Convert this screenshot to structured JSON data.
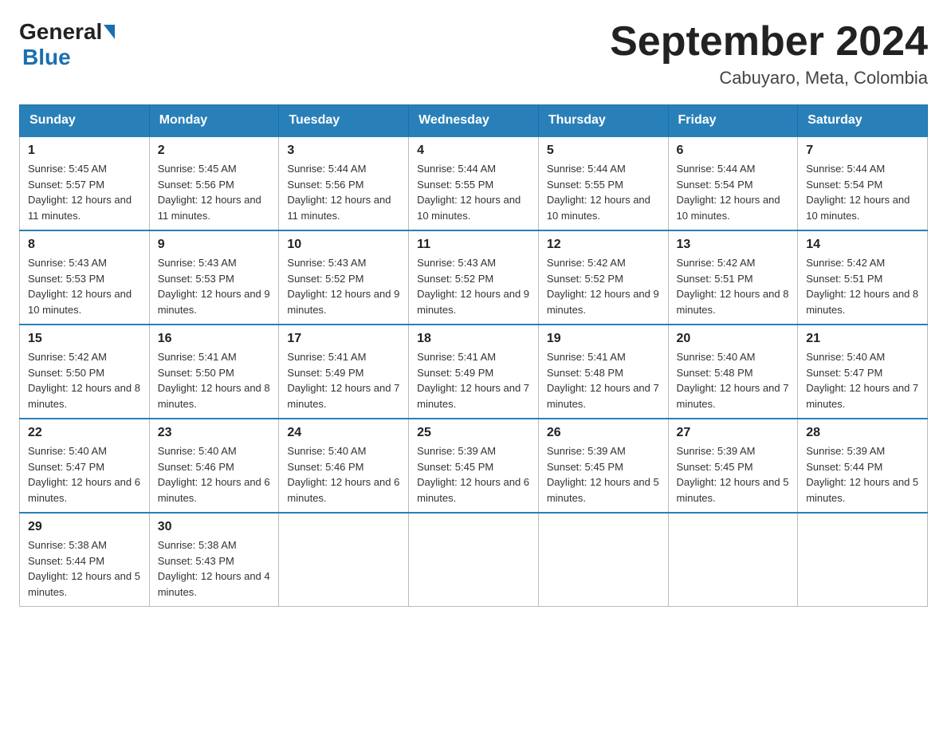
{
  "logo": {
    "general": "General",
    "blue": "Blue"
  },
  "header": {
    "month_year": "September 2024",
    "location": "Cabuyaro, Meta, Colombia"
  },
  "days_of_week": [
    "Sunday",
    "Monday",
    "Tuesday",
    "Wednesday",
    "Thursday",
    "Friday",
    "Saturday"
  ],
  "weeks": [
    [
      {
        "num": "1",
        "sunrise": "5:45 AM",
        "sunset": "5:57 PM",
        "daylight": "12 hours and 11 minutes."
      },
      {
        "num": "2",
        "sunrise": "5:45 AM",
        "sunset": "5:56 PM",
        "daylight": "12 hours and 11 minutes."
      },
      {
        "num": "3",
        "sunrise": "5:44 AM",
        "sunset": "5:56 PM",
        "daylight": "12 hours and 11 minutes."
      },
      {
        "num": "4",
        "sunrise": "5:44 AM",
        "sunset": "5:55 PM",
        "daylight": "12 hours and 10 minutes."
      },
      {
        "num": "5",
        "sunrise": "5:44 AM",
        "sunset": "5:55 PM",
        "daylight": "12 hours and 10 minutes."
      },
      {
        "num": "6",
        "sunrise": "5:44 AM",
        "sunset": "5:54 PM",
        "daylight": "12 hours and 10 minutes."
      },
      {
        "num": "7",
        "sunrise": "5:44 AM",
        "sunset": "5:54 PM",
        "daylight": "12 hours and 10 minutes."
      }
    ],
    [
      {
        "num": "8",
        "sunrise": "5:43 AM",
        "sunset": "5:53 PM",
        "daylight": "12 hours and 10 minutes."
      },
      {
        "num": "9",
        "sunrise": "5:43 AM",
        "sunset": "5:53 PM",
        "daylight": "12 hours and 9 minutes."
      },
      {
        "num": "10",
        "sunrise": "5:43 AM",
        "sunset": "5:52 PM",
        "daylight": "12 hours and 9 minutes."
      },
      {
        "num": "11",
        "sunrise": "5:43 AM",
        "sunset": "5:52 PM",
        "daylight": "12 hours and 9 minutes."
      },
      {
        "num": "12",
        "sunrise": "5:42 AM",
        "sunset": "5:52 PM",
        "daylight": "12 hours and 9 minutes."
      },
      {
        "num": "13",
        "sunrise": "5:42 AM",
        "sunset": "5:51 PM",
        "daylight": "12 hours and 8 minutes."
      },
      {
        "num": "14",
        "sunrise": "5:42 AM",
        "sunset": "5:51 PM",
        "daylight": "12 hours and 8 minutes."
      }
    ],
    [
      {
        "num": "15",
        "sunrise": "5:42 AM",
        "sunset": "5:50 PM",
        "daylight": "12 hours and 8 minutes."
      },
      {
        "num": "16",
        "sunrise": "5:41 AM",
        "sunset": "5:50 PM",
        "daylight": "12 hours and 8 minutes."
      },
      {
        "num": "17",
        "sunrise": "5:41 AM",
        "sunset": "5:49 PM",
        "daylight": "12 hours and 7 minutes."
      },
      {
        "num": "18",
        "sunrise": "5:41 AM",
        "sunset": "5:49 PM",
        "daylight": "12 hours and 7 minutes."
      },
      {
        "num": "19",
        "sunrise": "5:41 AM",
        "sunset": "5:48 PM",
        "daylight": "12 hours and 7 minutes."
      },
      {
        "num": "20",
        "sunrise": "5:40 AM",
        "sunset": "5:48 PM",
        "daylight": "12 hours and 7 minutes."
      },
      {
        "num": "21",
        "sunrise": "5:40 AM",
        "sunset": "5:47 PM",
        "daylight": "12 hours and 7 minutes."
      }
    ],
    [
      {
        "num": "22",
        "sunrise": "5:40 AM",
        "sunset": "5:47 PM",
        "daylight": "12 hours and 6 minutes."
      },
      {
        "num": "23",
        "sunrise": "5:40 AM",
        "sunset": "5:46 PM",
        "daylight": "12 hours and 6 minutes."
      },
      {
        "num": "24",
        "sunrise": "5:40 AM",
        "sunset": "5:46 PM",
        "daylight": "12 hours and 6 minutes."
      },
      {
        "num": "25",
        "sunrise": "5:39 AM",
        "sunset": "5:45 PM",
        "daylight": "12 hours and 6 minutes."
      },
      {
        "num": "26",
        "sunrise": "5:39 AM",
        "sunset": "5:45 PM",
        "daylight": "12 hours and 5 minutes."
      },
      {
        "num": "27",
        "sunrise": "5:39 AM",
        "sunset": "5:45 PM",
        "daylight": "12 hours and 5 minutes."
      },
      {
        "num": "28",
        "sunrise": "5:39 AM",
        "sunset": "5:44 PM",
        "daylight": "12 hours and 5 minutes."
      }
    ],
    [
      {
        "num": "29",
        "sunrise": "5:38 AM",
        "sunset": "5:44 PM",
        "daylight": "12 hours and 5 minutes."
      },
      {
        "num": "30",
        "sunrise": "5:38 AM",
        "sunset": "5:43 PM",
        "daylight": "12 hours and 4 minutes."
      },
      null,
      null,
      null,
      null,
      null
    ]
  ],
  "labels": {
    "sunrise": "Sunrise:",
    "sunset": "Sunset:",
    "daylight": "Daylight:"
  }
}
